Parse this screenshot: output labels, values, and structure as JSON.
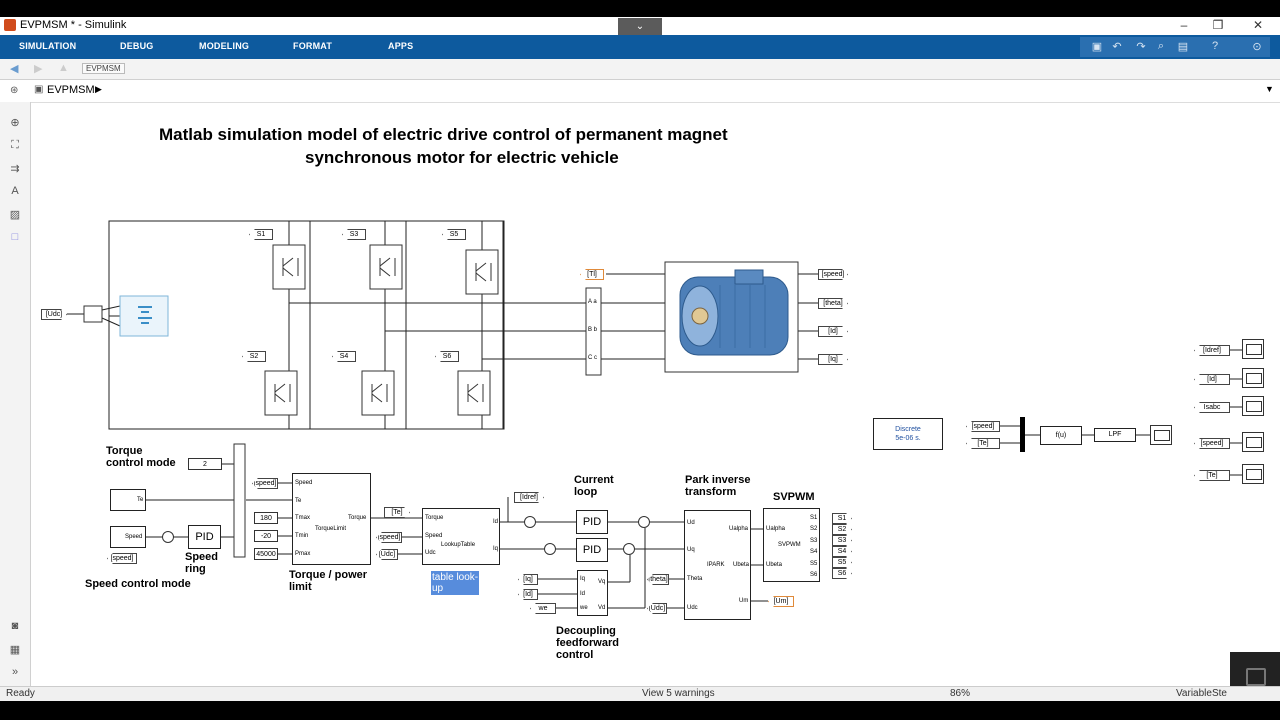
{
  "window": {
    "title": "EVPMSM * - Simulink",
    "min": "–",
    "max": "❒",
    "close": "✕",
    "collapse": "⌄"
  },
  "ribbon": {
    "tabs": [
      "SIMULATION",
      "DEBUG",
      "MODELING",
      "FORMAT",
      "APPS"
    ]
  },
  "nav": {
    "tab": "EVPMSM",
    "breadcrumb": "EVPMSM"
  },
  "diagram": {
    "title_line1": "Matlab simulation model of electric drive control of permanent magnet",
    "title_line2": "synchronous motor for electric vehicle",
    "switch_tags": [
      "S1",
      "S3",
      "S5",
      "S2",
      "S4",
      "S6"
    ],
    "udc_tag": "[Udc]",
    "tl_tag": "[Tl]",
    "motor_outputs": [
      "[speed]",
      "[theta]",
      "[Id]",
      "[Iq]"
    ],
    "abc_ports": [
      "A a",
      "B b",
      "C c"
    ],
    "torque_mode_label": "Torque\ncontrol mode",
    "speed_mode_label": "Speed control mode",
    "speed_ring_label": "Speed\nring",
    "torque_limit_label": "Torque / power\nlimit",
    "current_loop_label": "Current\nloop",
    "park_label": "Park inverse\ntransform",
    "svpwm_label": "SVPWM",
    "decoupling_label": "Decoupling\nfeedforward\ncontrol",
    "table_label": "table look-\nup",
    "const_2": "2",
    "const_180": "180",
    "const_n20": "-20",
    "const_45000": "45000",
    "pid": "PID",
    "torque_limit_block": "TorqueLimit",
    "lookup_block": "LookupTable",
    "ipark_block": "IPARK",
    "svpwm_block": "SVPWM",
    "discrete": "Discrete\n5e-06 s.",
    "fu": "f(u)",
    "lpf": "LPF",
    "right_tags": [
      "[Idref]",
      "[Id]",
      "Isabc",
      "[speed]",
      "[Te]"
    ],
    "mux_tags": [
      "[speed]",
      "[Te]"
    ],
    "svpwm_outputs": [
      "S1",
      "S2",
      "S3",
      "S4",
      "S5",
      "S6"
    ],
    "te_tag": "[Te]",
    "idref_tag": "[Idref]",
    "um_tag": "[Um]",
    "iq_tag": "[Iq]",
    "id_tag": "[Id]",
    "we_tag": "we",
    "theta_tag": "[theta]",
    "udc_in_tag": "[Udc]",
    "speed_in_tag": "[speed]",
    "torque_ports_in": [
      "Speed",
      "Te",
      "Tmax",
      "Tmin",
      "Pmax"
    ],
    "torque_port_out": "Torque",
    "lookup_ports_in": [
      "Torque",
      "Speed",
      "Udc"
    ],
    "lookup_ports_out": [
      "Id",
      "Iq"
    ],
    "ipark_ports_in": [
      "Ud",
      "Uq",
      "Theta",
      "Udc"
    ],
    "ipark_ports_out": [
      "Ualpha",
      "Ubeta",
      "Um"
    ],
    "svpwm_ports_in": [
      "Ualpha",
      "Ubeta"
    ],
    "decoup_ports_in": [
      "Iq",
      "Id",
      "we"
    ],
    "decoup_ports_out": [
      "Vq",
      "Vd"
    ]
  },
  "status": {
    "left": "Ready",
    "center": "View 5 warnings",
    "zoom": "86%",
    "right": "VariableSte"
  }
}
